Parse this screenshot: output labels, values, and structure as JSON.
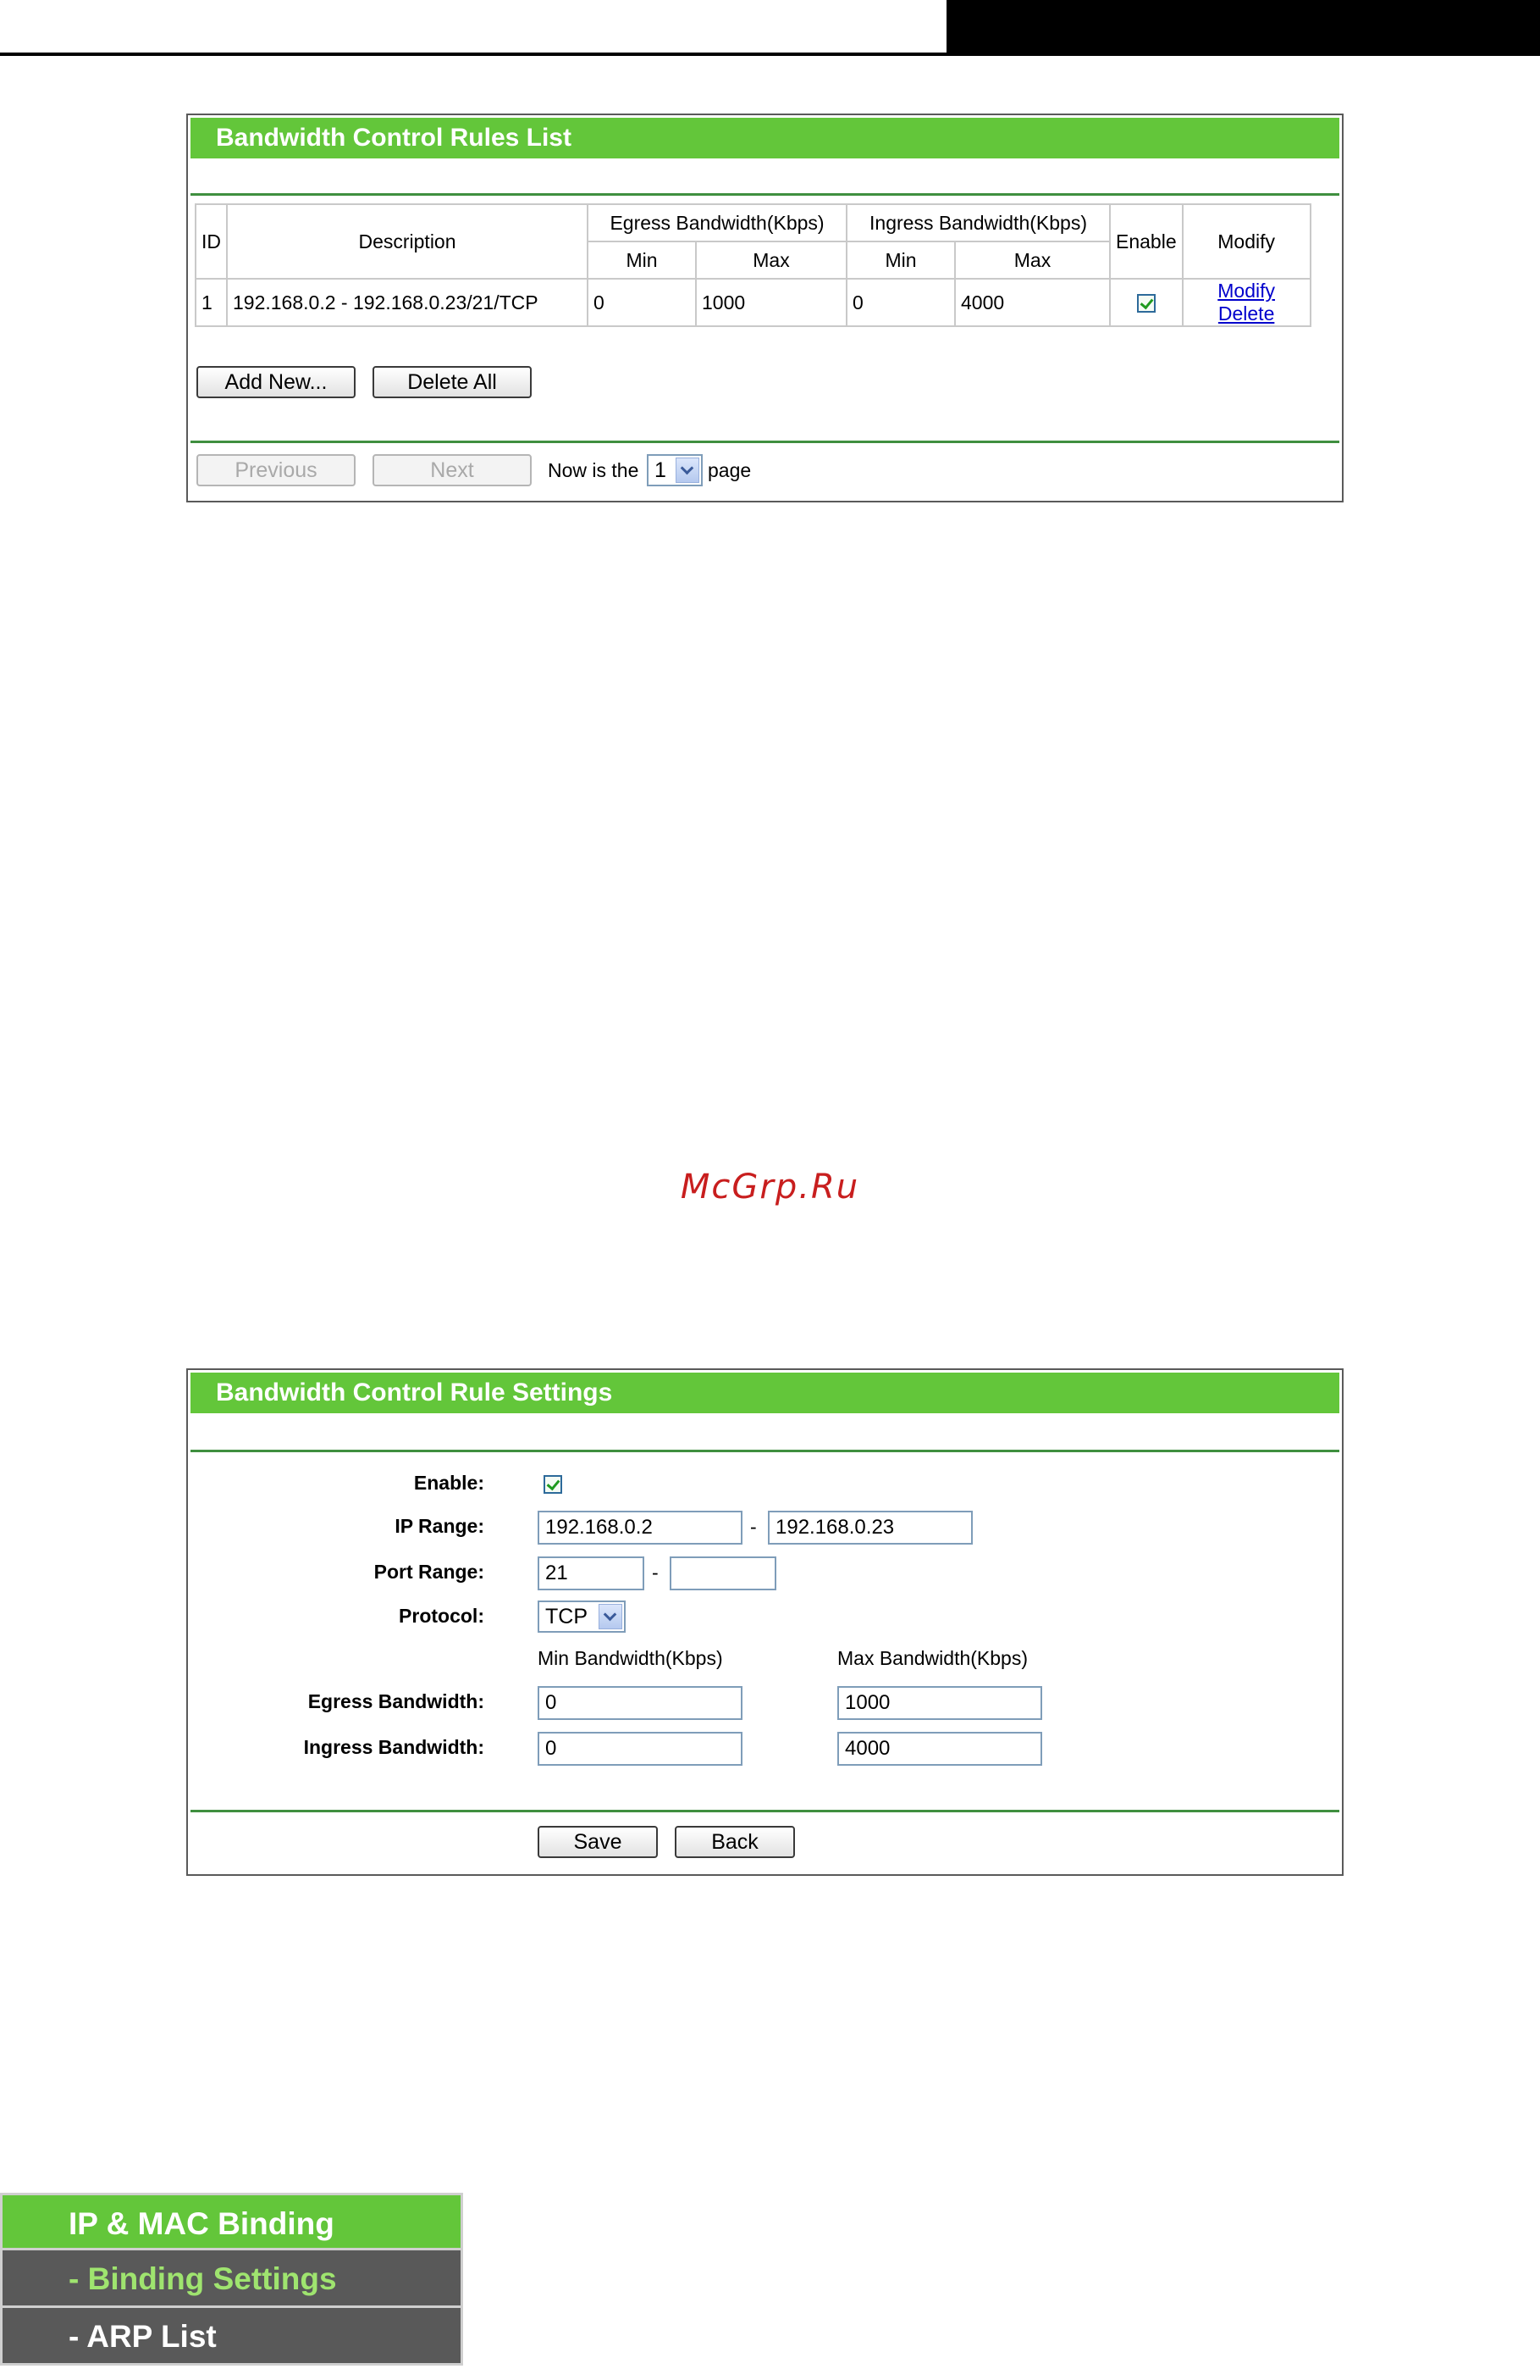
{
  "rules_list": {
    "title": "Bandwidth Control Rules List",
    "headers": {
      "id": "ID",
      "description": "Description",
      "egress": "Egress Bandwidth(Kbps)",
      "ingress": "Ingress Bandwidth(Kbps)",
      "min": "Min",
      "max": "Max",
      "enable": "Enable",
      "modify": "Modify"
    },
    "rows": [
      {
        "id": "1",
        "description": "192.168.0.2 - 192.168.0.23/21/TCP",
        "egress_min": "0",
        "egress_max": "1000",
        "ingress_min": "0",
        "ingress_max": "4000",
        "enabled": true,
        "modify_label": "Modify",
        "delete_label": "Delete"
      }
    ],
    "add_new_label": "Add New...",
    "delete_all_label": "Delete All",
    "previous_label": "Previous",
    "next_label": "Next",
    "now_is_the": "Now is the",
    "page_word": "page",
    "current_page": "1"
  },
  "watermark": "McGrp.Ru",
  "rule_settings": {
    "title": "Bandwidth Control Rule Settings",
    "enable_label": "Enable:",
    "enabled": true,
    "ip_range_label": "IP Range:",
    "ip_start": "192.168.0.2",
    "ip_end": "192.168.0.23",
    "port_range_label": "Port Range:",
    "port_start": "21",
    "port_end": "",
    "protocol_label": "Protocol:",
    "protocol": "TCP",
    "min_bw_header": "Min Bandwidth(Kbps)",
    "max_bw_header": "Max Bandwidth(Kbps)",
    "egress_label": "Egress Bandwidth:",
    "egress_min": "0",
    "egress_max": "1000",
    "ingress_label": "Ingress Bandwidth:",
    "ingress_min": "0",
    "ingress_max": "4000",
    "dash": "-",
    "save_label": "Save",
    "back_label": "Back"
  },
  "menu": {
    "items": [
      {
        "label": "IP & MAC Binding"
      },
      {
        "label": "- Binding Settings"
      },
      {
        "label": "- ARP List"
      }
    ]
  },
  "colors": {
    "header_green": "#63c63a",
    "menu_gray": "#595959",
    "menu_selected_text": "#9fe46f",
    "link_blue": "#0000cc"
  }
}
